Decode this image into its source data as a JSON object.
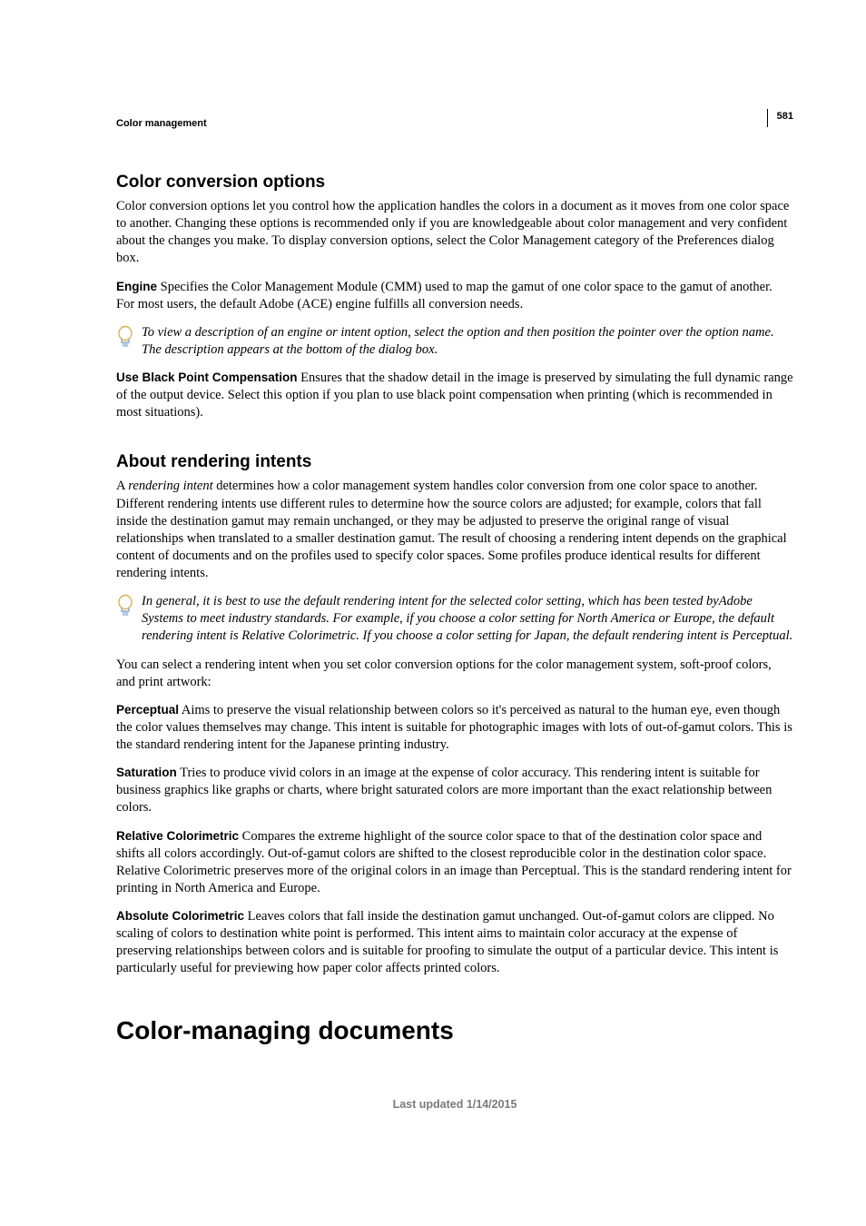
{
  "page_number": "581",
  "breadcrumb": "Color management",
  "h2_a": "Color conversion options",
  "p_intro": "Color conversion options let you control how the application handles the colors in a document as it moves from one color space to another. Changing these options is recommended only if you are knowledgeable about color management and very confident about the changes you make. To display conversion options, select the Color Management category of the Preferences dialog box.",
  "engine_label": "Engine",
  "engine_text": "  Specifies the Color Management Module (CMM) used to map the gamut of one color space to the gamut of another. For most users, the default Adobe (ACE) engine fulfills all conversion needs.",
  "tip1": "To view a description of an engine or intent option, select the option and then position the pointer over the option name. The description appears at the bottom of the dialog box.",
  "bpc_label": "Use Black Point Compensation",
  "bpc_text": "  Ensures that the shadow detail in the image is preserved by simulating the full dynamic range of the output device. Select this option if you plan to use black point compensation when printing (which is recommended in most situations).",
  "h2_b": "About rendering intents",
  "ri_p1_a": "A ",
  "ri_p1_em": "rendering intent",
  "ri_p1_b": " determines how a color management system handles color conversion from one color space to another. Different rendering intents use different rules to determine how the source colors are adjusted; for example, colors that fall inside the destination gamut may remain unchanged, or they may be adjusted to preserve the original range of visual relationships when translated to a smaller destination gamut. The result of choosing a rendering intent depends on the graphical content of documents and on the profiles used to specify color spaces. Some profiles produce identical results for different rendering intents.",
  "tip2": "In general, it is best to use the default rendering intent for the selected color setting, which has been tested byAdobe Systems to meet industry standards. For example, if you choose a color setting for North America or Europe, the default rendering intent is Relative Colorimetric. If you choose a color setting for Japan, the default rendering intent is Perceptual.",
  "ri_p2": "You can select a rendering intent when you set color conversion options for the color management system, soft-proof colors, and print artwork:",
  "perc_label": "Perceptual",
  "perc_text": "  Aims to preserve the visual relationship between colors so it's perceived as natural to the human eye, even though the color values themselves may change. This intent is suitable for photographic images with lots of out-of-gamut colors. This is the standard rendering intent for the Japanese printing industry.",
  "sat_label": "Saturation",
  "sat_text": "  Tries to produce vivid colors in an image at the expense of color accuracy. This rendering intent is suitable for business graphics like graphs or charts, where bright saturated colors are more important than the exact relationship between colors.",
  "rel_label": "Relative Colorimetric",
  "rel_text": "  Compares the extreme highlight of the source color space to that of the destination color space and shifts all colors accordingly. Out-of-gamut colors are shifted to the closest reproducible color in the destination color space. Relative Colorimetric preserves more of the original colors in an image than Perceptual. This is the standard rendering intent for printing in North America and Europe.",
  "abs_label": "Absolute Colorimetric",
  "abs_text": "  Leaves colors that fall inside the destination gamut unchanged. Out-of-gamut colors are clipped. No scaling of colors to destination white point is performed. This intent aims to maintain color accuracy at the expense of preserving relationships between colors and is suitable for proofing to simulate the output of a particular device. This intent is particularly useful for previewing how paper color affects printed colors.",
  "h1": "Color-managing documents",
  "footer": "Last updated 1/14/2015"
}
